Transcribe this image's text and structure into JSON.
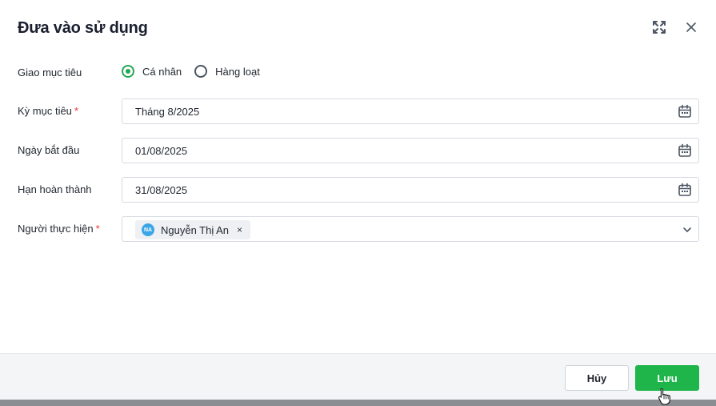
{
  "dialog": {
    "title": "Đưa vào sử dụng"
  },
  "form": {
    "assign_target": {
      "label": "Giao mục tiêu",
      "options": [
        "Cá nhân",
        "Hàng loạt"
      ],
      "selected": "Cá nhân"
    },
    "period": {
      "label": "Kỳ mục tiêu",
      "required_mark": "*",
      "value": "Tháng 8/2025"
    },
    "start_date": {
      "label": "Ngày bắt đầu",
      "value": "01/08/2025"
    },
    "due_date": {
      "label": "Hạn hoàn thành",
      "value": "31/08/2025"
    },
    "assignee": {
      "label": "Người thực hiện",
      "required_mark": "*",
      "chips": [
        {
          "initials": "NA",
          "name": "Nguyễn Thị An",
          "remove": "×"
        }
      ]
    }
  },
  "footer": {
    "cancel_label": "Hủy",
    "save_label": "Lưu"
  },
  "colors": {
    "accent_green": "#1fb54a",
    "radio_checked": "#22a755",
    "required": "#e53935",
    "avatar_blue": "#3aa6e8"
  },
  "icons": {
    "expand": "expand-icon",
    "close": "close-icon",
    "calendar": "calendar-icon",
    "dropdown": "chevron-down-icon",
    "cursor": "hand-pointer-icon"
  }
}
